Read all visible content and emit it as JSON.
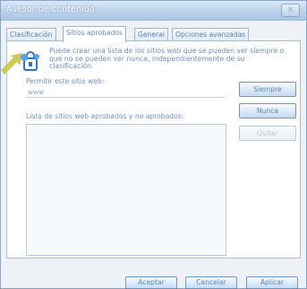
{
  "window": {
    "title": "Asesor de contenido",
    "close_glyph": "✕"
  },
  "tabs": [
    {
      "label": "Clasificación",
      "active": false
    },
    {
      "label": "Sitios aprobados",
      "active": true
    },
    {
      "label": "General",
      "active": false
    },
    {
      "label": "Opciones avanzadas",
      "active": false
    }
  ],
  "panel": {
    "description": "Puede crear una lista de los sitios web que se pueden ver siempre o que no se pueden ver nunca, independientemente de su clasificación.",
    "site_label": "Permitir este sitio web:",
    "site_input_value": "www",
    "list_label": "Lista de sitios web aprobados y no aprobados:",
    "buttons": {
      "always": "Siempre",
      "never": "Nunca",
      "remove": "Quitar"
    }
  },
  "footer": {
    "accept": "Aceptar",
    "cancel": "Cancelar",
    "apply": "Aplicar"
  },
  "colors": {
    "accent_arrow": "#c8c040",
    "icon_blue": "#2f75c9"
  }
}
